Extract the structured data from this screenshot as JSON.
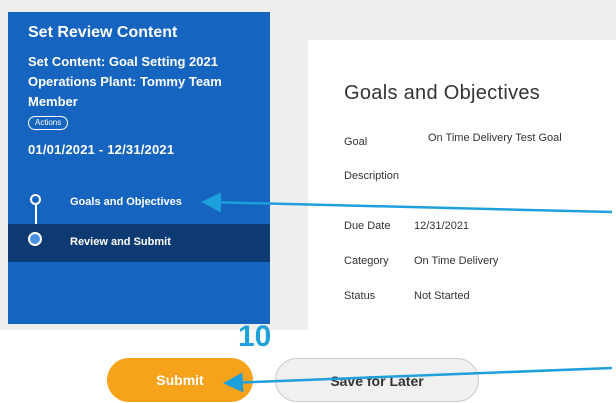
{
  "sidebar": {
    "title": "Set Review Content",
    "subtitle": "Set Content: Goal Setting 2021 Operations Plant: Tommy Team Member",
    "actions_label": "Actions",
    "date_range": "01/01/2021 - 12/31/2021",
    "steps": [
      {
        "label": "Goals and Objectives"
      },
      {
        "label": "Review and Submit"
      }
    ]
  },
  "main": {
    "title": "Goals and Objectives",
    "fields": [
      {
        "label": "Goal",
        "value": "On Time Delivery Test Goal"
      },
      {
        "label": "Description",
        "value": ""
      },
      {
        "label": "Due Date",
        "value": "12/31/2021"
      },
      {
        "label": "Category",
        "value": "On Time Delivery"
      },
      {
        "label": "Status",
        "value": "Not Started"
      }
    ]
  },
  "footer": {
    "submit_label": "Submit",
    "save_label": "Save for Later"
  },
  "annotation": {
    "step_number": "10"
  },
  "colors": {
    "sidebar_bg": "#1565c0",
    "active_step_bg": "#0d3a73",
    "submit": "#f7a21b",
    "annotation": "#1ea0dc"
  }
}
